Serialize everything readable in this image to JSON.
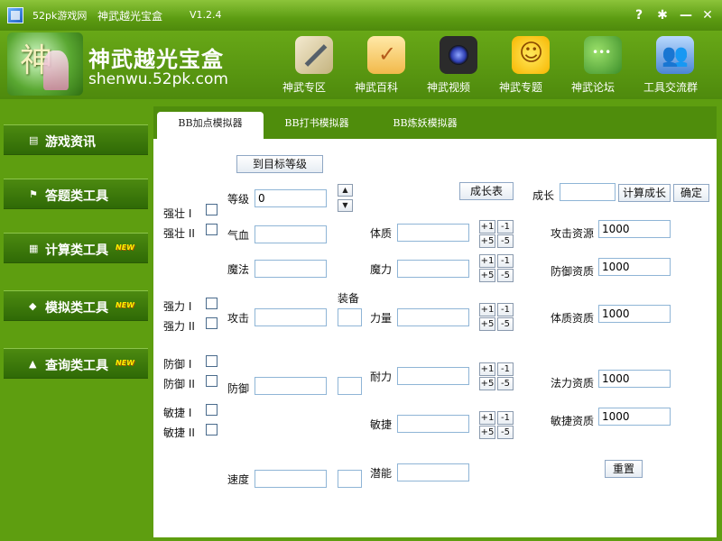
{
  "window": {
    "site": "52pk游戏网",
    "title": "神武越光宝盒",
    "version": "V1.2.4",
    "help_label": "?",
    "settings_label": "✱",
    "minimize_label": "—",
    "close_label": "✕"
  },
  "header": {
    "brand_title": "神武越光宝盒",
    "brand_url": "shenwu.52pk.com",
    "nav": [
      {
        "label": "神武专区",
        "icon": "sword-icon"
      },
      {
        "label": "神武百科",
        "icon": "notepad-icon"
      },
      {
        "label": "神武视频",
        "icon": "camera-icon"
      },
      {
        "label": "神武专题",
        "icon": "star-icon"
      },
      {
        "label": "神武论坛",
        "icon": "chat-icon"
      },
      {
        "label": "工具交流群",
        "icon": "people-icon"
      }
    ]
  },
  "sidebar": {
    "items": [
      {
        "label": "游戏资讯",
        "icon": "news-icon",
        "new": ""
      },
      {
        "label": "答题类工具",
        "icon": "flag-icon",
        "new": ""
      },
      {
        "label": "计算类工具",
        "icon": "calculator-icon",
        "new": "NEW"
      },
      {
        "label": "模拟类工具",
        "icon": "gamepad-icon",
        "new": "NEW"
      },
      {
        "label": "查询类工具",
        "icon": "thumb-icon",
        "new": "NEW"
      }
    ]
  },
  "tabs": [
    {
      "label": "BB加点模拟器"
    },
    {
      "label": "BB打书模拟器"
    },
    {
      "label": "BB炼妖模拟器"
    }
  ],
  "sim": {
    "target_level_button": "到目标等级",
    "growth_table_button": "成长表",
    "growth_label": "成长",
    "growth_value": "",
    "calc_growth_button": "计算成长",
    "confirm_button": "确定",
    "reset_button": "重置",
    "level_label": "等级",
    "level_value": "0",
    "equip_label": "装备",
    "checks": {
      "str1": "强壮 I",
      "str2": "强壮 II",
      "pow1": "强力 I",
      "pow2": "强力 II",
      "def1": "防御 I",
      "def2": "防御 II",
      "agi1": "敏捷 I",
      "agi2": "敏捷 II"
    },
    "left": {
      "hp": "气血",
      "mp": "魔法",
      "atk": "攻击",
      "def": "防御",
      "spd": "速度"
    },
    "mid": {
      "con": "体质",
      "mag": "魔力",
      "str": "力量",
      "end": "耐力",
      "agi": "敏捷",
      "pot": "潜能"
    },
    "step": {
      "p1": "+1",
      "m1": "-1",
      "p5": "+5",
      "m5": "-5"
    },
    "apt": {
      "atk_label": "攻击资源",
      "atk": "1000",
      "def_label": "防御资质",
      "def": "1000",
      "con_label": "体质资质",
      "con": "1000",
      "mag_label": "法力资质",
      "mag": "1000",
      "agi_label": "敏捷资质",
      "agi": "1000"
    }
  }
}
